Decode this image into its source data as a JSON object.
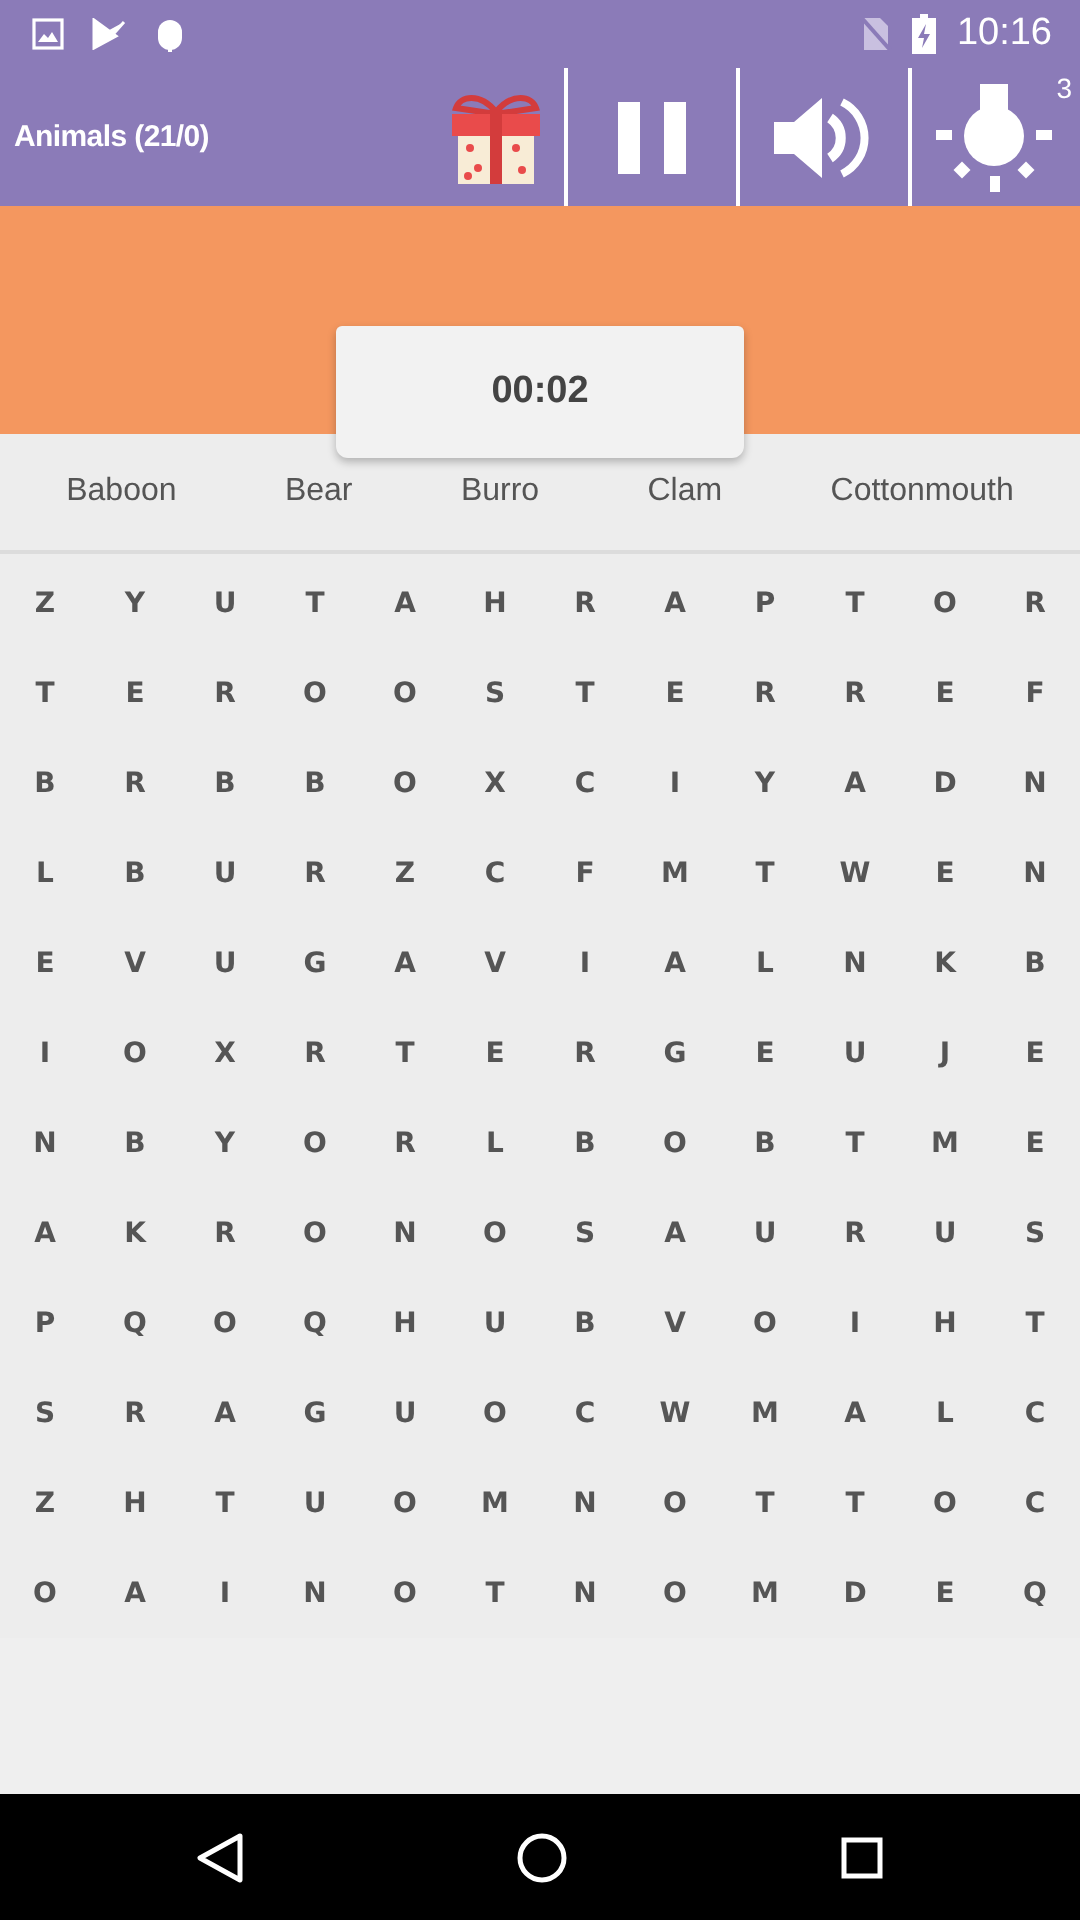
{
  "status_bar": {
    "time": "10:16"
  },
  "toolbar": {
    "title": "Animals (21/0)",
    "hint_count": "3"
  },
  "timer": "00:02",
  "words": [
    "Baboon",
    "Bear",
    "Burro",
    "Clam",
    "Cottonmouth"
  ],
  "grid": [
    [
      "Z",
      "Y",
      "U",
      "T",
      "A",
      "H",
      "R",
      "A",
      "P",
      "T",
      "O",
      "R"
    ],
    [
      "T",
      "E",
      "R",
      "O",
      "O",
      "S",
      "T",
      "E",
      "R",
      "R",
      "E",
      "F"
    ],
    [
      "B",
      "R",
      "B",
      "B",
      "O",
      "X",
      "C",
      "I",
      "Y",
      "A",
      "D",
      "N"
    ],
    [
      "L",
      "B",
      "U",
      "R",
      "Z",
      "C",
      "F",
      "M",
      "T",
      "W",
      "E",
      "N"
    ],
    [
      "E",
      "V",
      "U",
      "G",
      "A",
      "V",
      "I",
      "A",
      "L",
      "N",
      "K",
      "B"
    ],
    [
      "I",
      "O",
      "X",
      "R",
      "T",
      "E",
      "R",
      "G",
      "E",
      "U",
      "J",
      "E"
    ],
    [
      "N",
      "B",
      "Y",
      "O",
      "R",
      "L",
      "B",
      "O",
      "B",
      "T",
      "M",
      "E"
    ],
    [
      "A",
      "K",
      "R",
      "O",
      "N",
      "O",
      "S",
      "A",
      "U",
      "R",
      "U",
      "S"
    ],
    [
      "P",
      "Q",
      "O",
      "Q",
      "H",
      "U",
      "B",
      "V",
      "O",
      "I",
      "H",
      "T"
    ],
    [
      "S",
      "R",
      "A",
      "G",
      "U",
      "O",
      "C",
      "W",
      "M",
      "A",
      "L",
      "C"
    ],
    [
      "Z",
      "H",
      "T",
      "U",
      "O",
      "M",
      "N",
      "O",
      "T",
      "T",
      "O",
      "C"
    ],
    [
      "O",
      "A",
      "I",
      "N",
      "O",
      "T",
      "N",
      "O",
      "M",
      "D",
      "E",
      "Q"
    ]
  ]
}
